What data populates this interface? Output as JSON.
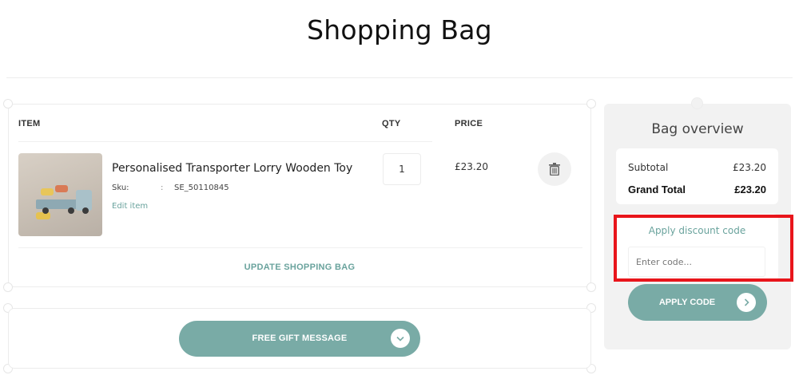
{
  "page": {
    "title": "Shopping Bag"
  },
  "cart": {
    "headers": {
      "item": "ITEM",
      "qty": "QTY",
      "price": "PRICE"
    },
    "items": [
      {
        "name": "Personalised Transporter Lorry Wooden Toy",
        "sku_label": "Sku:",
        "sku_separator": ":",
        "sku_value": "SE_50110845",
        "edit_label": "Edit item",
        "qty": "1",
        "price": "£23.20",
        "image_icon": "toy-lorry-photo",
        "delete_icon": "trash-icon"
      }
    ],
    "update_label": "UPDATE SHOPPING BAG"
  },
  "gift": {
    "label": "FREE GIFT MESSAGE",
    "icon": "chevron-down-icon"
  },
  "overview": {
    "title": "Bag overview",
    "subtotal_label": "Subtotal",
    "subtotal_value": "£23.20",
    "grand_total_label": "Grand Total",
    "grand_total_value": "£23.20",
    "discount_link": "Apply discount code",
    "code_placeholder": "Enter code...",
    "apply_label": "APPLY CODE",
    "apply_icon": "chevron-right-icon"
  },
  "colors": {
    "accent": "#79aba6",
    "link": "#6aa39d",
    "highlight": "#e8151b",
    "panel": "#f2f2f2"
  }
}
